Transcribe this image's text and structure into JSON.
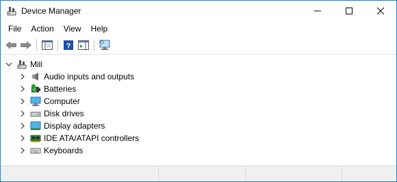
{
  "window": {
    "title": "Device Manager",
    "app_icon": "device-manager-icon",
    "accent_color": "#1883d7",
    "controls": [
      "minimize-icon",
      "maximize-icon",
      "close-icon"
    ]
  },
  "menu": {
    "items": [
      {
        "label": "File"
      },
      {
        "label": "Action"
      },
      {
        "label": "View"
      },
      {
        "label": "Help"
      }
    ]
  },
  "toolbar": {
    "buttons": [
      "back-icon",
      "forward-icon",
      "show-hide-console-tree-icon",
      "help-icon",
      "properties-pane-icon",
      "scan-hardware-icon"
    ]
  },
  "tree": {
    "root": {
      "label": "Mili",
      "icon": "computer-tree-icon",
      "expanded": true
    },
    "categories": [
      {
        "label": "Audio inputs and outputs",
        "icon": "speaker-icon"
      },
      {
        "label": "Batteries",
        "icon": "battery-icon"
      },
      {
        "label": "Computer",
        "icon": "monitor-icon"
      },
      {
        "label": "Disk drives",
        "icon": "disk-drive-icon"
      },
      {
        "label": "Display adapters",
        "icon": "display-adapter-icon"
      },
      {
        "label": "IDE ATA/ATAPI controllers",
        "icon": "ide-controller-icon"
      },
      {
        "label": "Keyboards",
        "icon": "keyboard-icon"
      }
    ]
  }
}
